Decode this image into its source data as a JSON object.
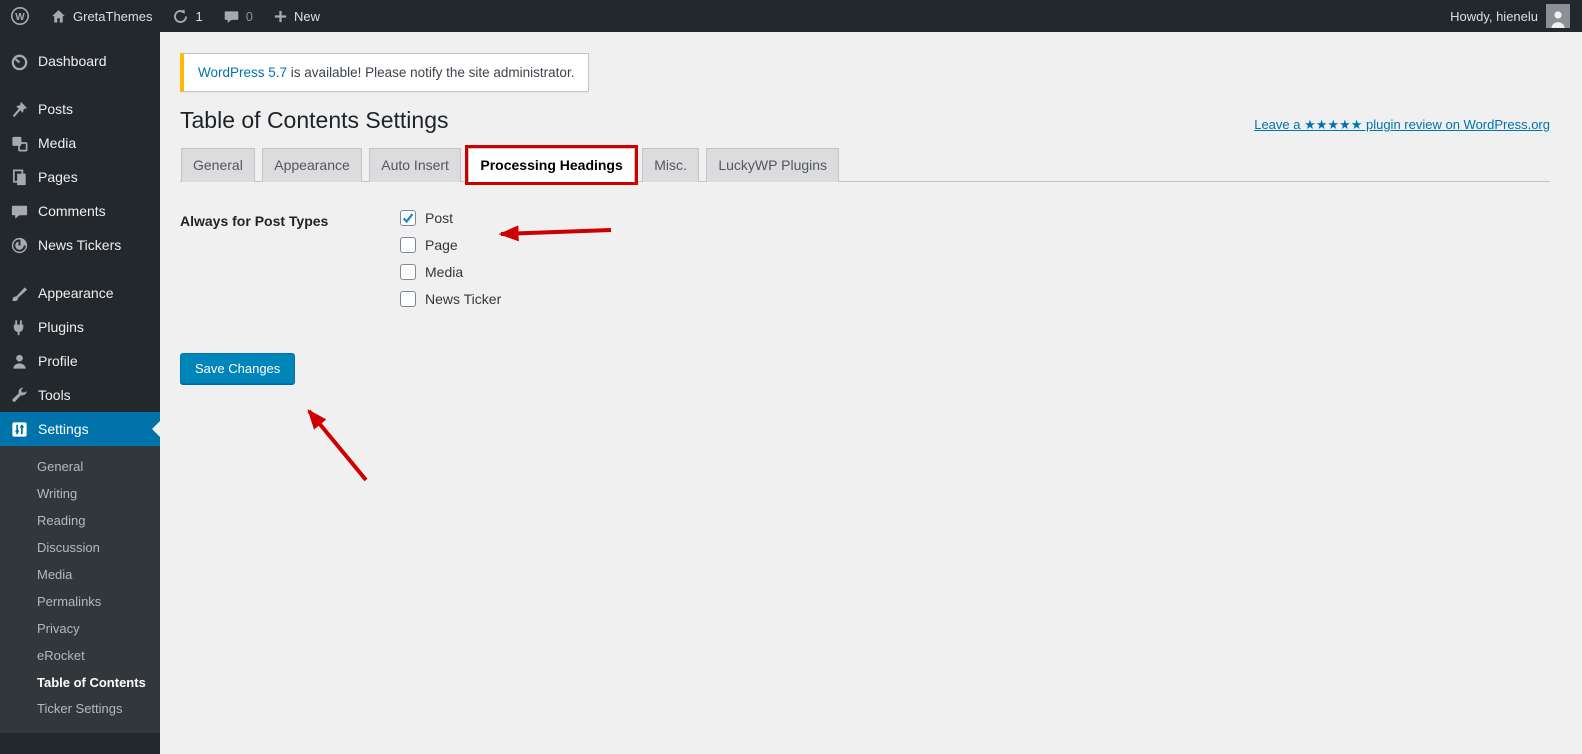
{
  "colors": {
    "accent_blue": "#0073aa",
    "button_blue": "#0085ba",
    "annotation_red": "#cc0000",
    "notice_accent": "#ffb900",
    "admin_dark": "#23282d",
    "submenu_dark": "#32373c",
    "page_bg": "#f0f0f1"
  },
  "admin_bar": {
    "site_name": "GretaThemes",
    "update_count": "1",
    "comment_count": "0",
    "new_label": "New",
    "howdy": "Howdy, hienelu",
    "icons": [
      "wordpress-logo",
      "home",
      "update-circular-arrows",
      "comment-bubble",
      "plus",
      "avatar"
    ]
  },
  "sidebar": {
    "items": [
      {
        "label": "Dashboard",
        "icon": "dashboard-gauge",
        "active": false
      },
      {
        "label": "Posts",
        "icon": "pushpin",
        "active": false
      },
      {
        "label": "Media",
        "icon": "media-note",
        "active": false
      },
      {
        "label": "Pages",
        "icon": "stacked-pages",
        "active": false
      },
      {
        "label": "Comments",
        "icon": "comment-bubble",
        "active": false
      },
      {
        "label": "News Tickers",
        "icon": "ticker-circle",
        "active": false
      },
      {
        "label": "Appearance",
        "icon": "paintbrush",
        "active": false
      },
      {
        "label": "Plugins",
        "icon": "plug",
        "active": false
      },
      {
        "label": "Profile",
        "icon": "person",
        "active": false
      },
      {
        "label": "Tools",
        "icon": "wrench",
        "active": false
      },
      {
        "label": "Settings",
        "icon": "sliders-panel",
        "active": true
      }
    ],
    "settings_submenu": [
      {
        "label": "General",
        "active": false
      },
      {
        "label": "Writing",
        "active": false
      },
      {
        "label": "Reading",
        "active": false
      },
      {
        "label": "Discussion",
        "active": false
      },
      {
        "label": "Media",
        "active": false
      },
      {
        "label": "Permalinks",
        "active": false
      },
      {
        "label": "Privacy",
        "active": false
      },
      {
        "label": "eRocket",
        "active": false
      },
      {
        "label": "Table of Contents",
        "active": true
      },
      {
        "label": "Ticker Settings",
        "active": false
      }
    ]
  },
  "notice": {
    "link_text": "WordPress 5.7",
    "rest_text": " is available! Please notify the site administrator."
  },
  "page": {
    "title": "Table of Contents Settings",
    "review_link": "Leave a ★★★★★ plugin review on WordPress.org"
  },
  "tabs": {
    "items": [
      {
        "label": "General",
        "active": false
      },
      {
        "label": "Appearance",
        "active": false
      },
      {
        "label": "Auto Insert",
        "active": false
      },
      {
        "label": "Processing Headings",
        "active": true,
        "annotation": "red-box"
      },
      {
        "label": "Misc.",
        "active": false
      },
      {
        "label": "LuckyWP Plugins",
        "active": false
      }
    ]
  },
  "form": {
    "field_label": "Always for Post Types",
    "checkboxes": [
      {
        "label": "Post",
        "checked": true
      },
      {
        "label": "Page",
        "checked": false
      },
      {
        "label": "Media",
        "checked": false
      },
      {
        "label": "News Ticker",
        "checked": false
      }
    ],
    "save_label": "Save Changes"
  },
  "annotations": {
    "arrow_1": "red arrow pointing at the checked Post checkbox",
    "arrow_2": "red arrow pointing at the Save Changes button"
  }
}
